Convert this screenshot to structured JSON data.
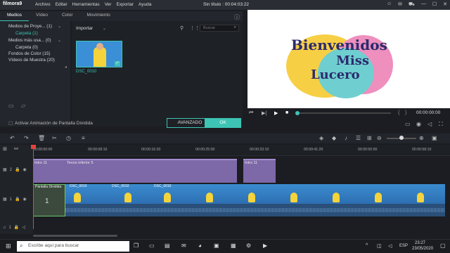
{
  "app": {
    "logo": "filmora9",
    "menu": [
      "Archivo",
      "Editar",
      "Herramientas",
      "Ver",
      "Exportar",
      "Ayuda"
    ],
    "project_title": "Sin título : 00:04:03:22"
  },
  "library": {
    "tabs": [
      "Medios",
      "Vídeo",
      "Color",
      "Movimiento"
    ],
    "active_tab": "Medios",
    "tree": [
      {
        "label": "Medios de Proye... (1)"
      },
      {
        "label": "Carpeta (1)"
      },
      {
        "label": "Medios más usa... (0)"
      },
      {
        "label": "Carpeta (0)"
      },
      {
        "label": "Fondos de Color (15)"
      },
      {
        "label": "Vídeos de Muestra (20)"
      }
    ],
    "import_label": "Importar",
    "search_placeholder": "Buscar",
    "thumb_label": "DSC_0010",
    "split_screen_label": "Activar Animación de Pantalla Dividida",
    "advanced_button": "AVANZADO",
    "ok_button": "OK"
  },
  "preview": {
    "title_line1": "Bienvenidos",
    "title_line2": "Miss",
    "title_line3": "Lucero",
    "timecode": "00:00:00:00",
    "bracket_left": "{",
    "bracket_right": "}"
  },
  "timeline": {
    "ticks": [
      "00:00:00:00",
      "00:00:08:10",
      "00:00:16:20",
      "00:00:25:00",
      "00:00:33:10",
      "00:00:41:20",
      "00:00:50:00",
      "00:00:58:10"
    ],
    "tracks": [
      {
        "num": "2"
      },
      {
        "num": "1"
      },
      {
        "num": "1"
      }
    ],
    "title_clips": [
      "Intro 11",
      "Tercio inferior 5",
      "Intro 11"
    ],
    "main_track_label": "1",
    "video_clip_labels": [
      "Pantalla Dividida",
      "DSC_0010",
      "DSC_0010",
      "DSC_0010"
    ]
  },
  "taskbar": {
    "search_placeholder": "Escribe aquí para buscar",
    "lang": "ESP",
    "time": "23:27",
    "date": "23/05/2020"
  }
}
